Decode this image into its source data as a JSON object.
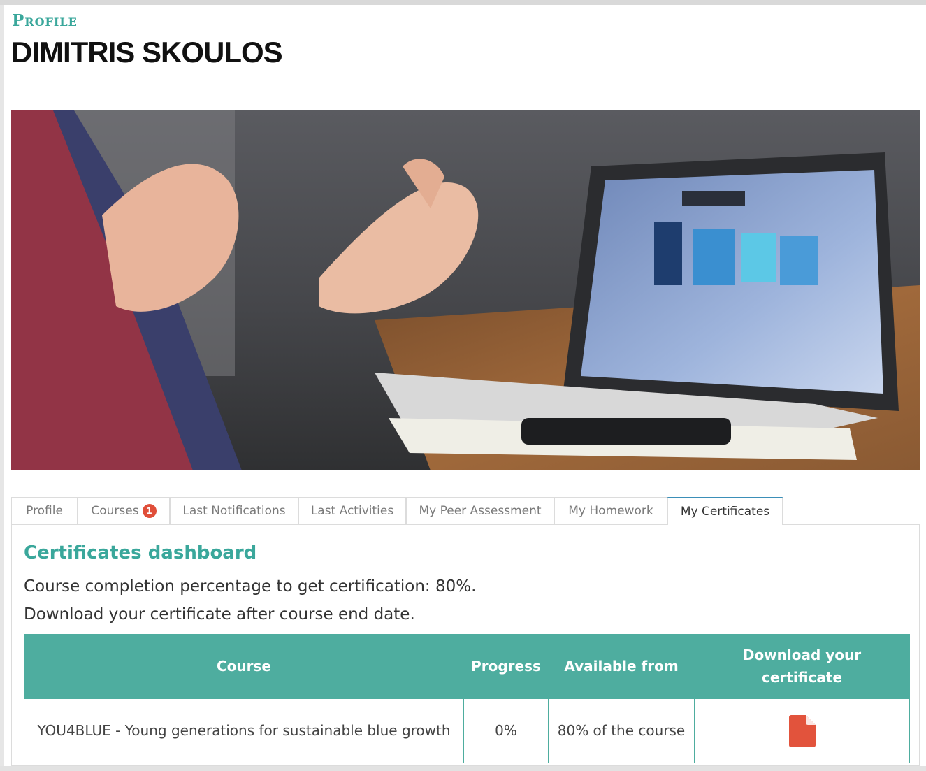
{
  "header": {
    "kicker": "Profile",
    "name": "DIMITRIS SKOULOS"
  },
  "tabs": [
    {
      "label": "Profile"
    },
    {
      "label": "Courses",
      "badge": "1"
    },
    {
      "label": "Last Notifications"
    },
    {
      "label": "Last Activities"
    },
    {
      "label": "My Peer Assessment"
    },
    {
      "label": "My Homework"
    },
    {
      "label": "My Certificates",
      "active": true
    }
  ],
  "certificates": {
    "title": "Certificates dashboard",
    "completion_text": "Course completion percentage to get certification: 80%.",
    "download_text": "Download your certificate after course end date.",
    "columns": [
      "Course",
      "Progress",
      "Available from",
      "Download your certificate"
    ],
    "rows": [
      {
        "course": "YOU4BLUE - Young generations for sustainable blue growth",
        "progress": "0%",
        "available_from": "80% of the course",
        "download_icon": "file-icon"
      }
    ]
  },
  "colors": {
    "accent": "#3aa79b",
    "table_header": "#4ead9f",
    "badge": "#e04e39",
    "file_icon": "#e2533c",
    "active_tab_border": "#3b8fb8"
  }
}
